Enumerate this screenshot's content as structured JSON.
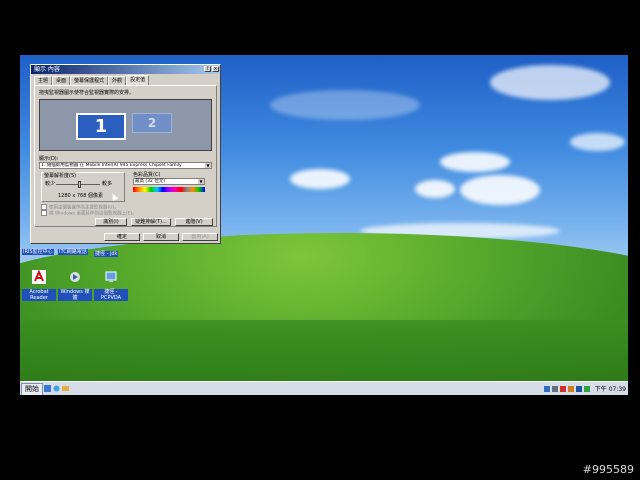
{
  "dialog": {
    "title": "顯示 內容",
    "tabs": [
      "主題",
      "桌面",
      "螢幕保護程式",
      "外觀",
      "設定值"
    ],
    "active_tab": "設定值",
    "instruction": "拖曳監視器圖示使符合監視器實際的安排。",
    "monitor1": "1",
    "monitor2": "2",
    "display_label": "顯示(D):",
    "display_value": "1. 隨插即用監視器 在 Mobile Intel(R) 945 Express Chipset Family",
    "resolution_label": "螢幕解析度(S)",
    "resolution_less": "較少",
    "resolution_more": "較多",
    "resolution_value": "1280 x 768 個像素",
    "color_label": "色彩品質(C)",
    "color_value": "最高 (32 位元)",
    "checkbox1": "使用這個裝置作為主要監視器(U)。",
    "checkbox2": "將 Windows 桌面延伸到這個監視器上(E)。",
    "btn_identify": "識別(I)",
    "btn_troubleshoot": "疑難排解(T)...",
    "btn_advanced": "進階(V)",
    "btn_ok": "確定",
    "btn_cancel": "取消",
    "btn_apply": "套用(A)"
  },
  "desktop": {
    "label_row": [
      "IRIS監控中心",
      "ITC網路電話",
      "捷徑 - jdk"
    ],
    "icons": [
      {
        "name": "acrobat-reader-icon",
        "label": "Acrobat Reader"
      },
      {
        "name": "windows-media-icon",
        "label": "Windows 媒體"
      },
      {
        "name": "network-icon",
        "label": "捷徑 - PCPVDA"
      }
    ]
  },
  "taskbar": {
    "start_label": "開始",
    "clock": "下午 07:39"
  },
  "watermark": "#995589",
  "colors": {
    "title_start": "#0a246a",
    "title_end": "#a6caf0",
    "dialog_bg": "#d4d0c8",
    "monitor_selected": "#2a5fbf"
  }
}
